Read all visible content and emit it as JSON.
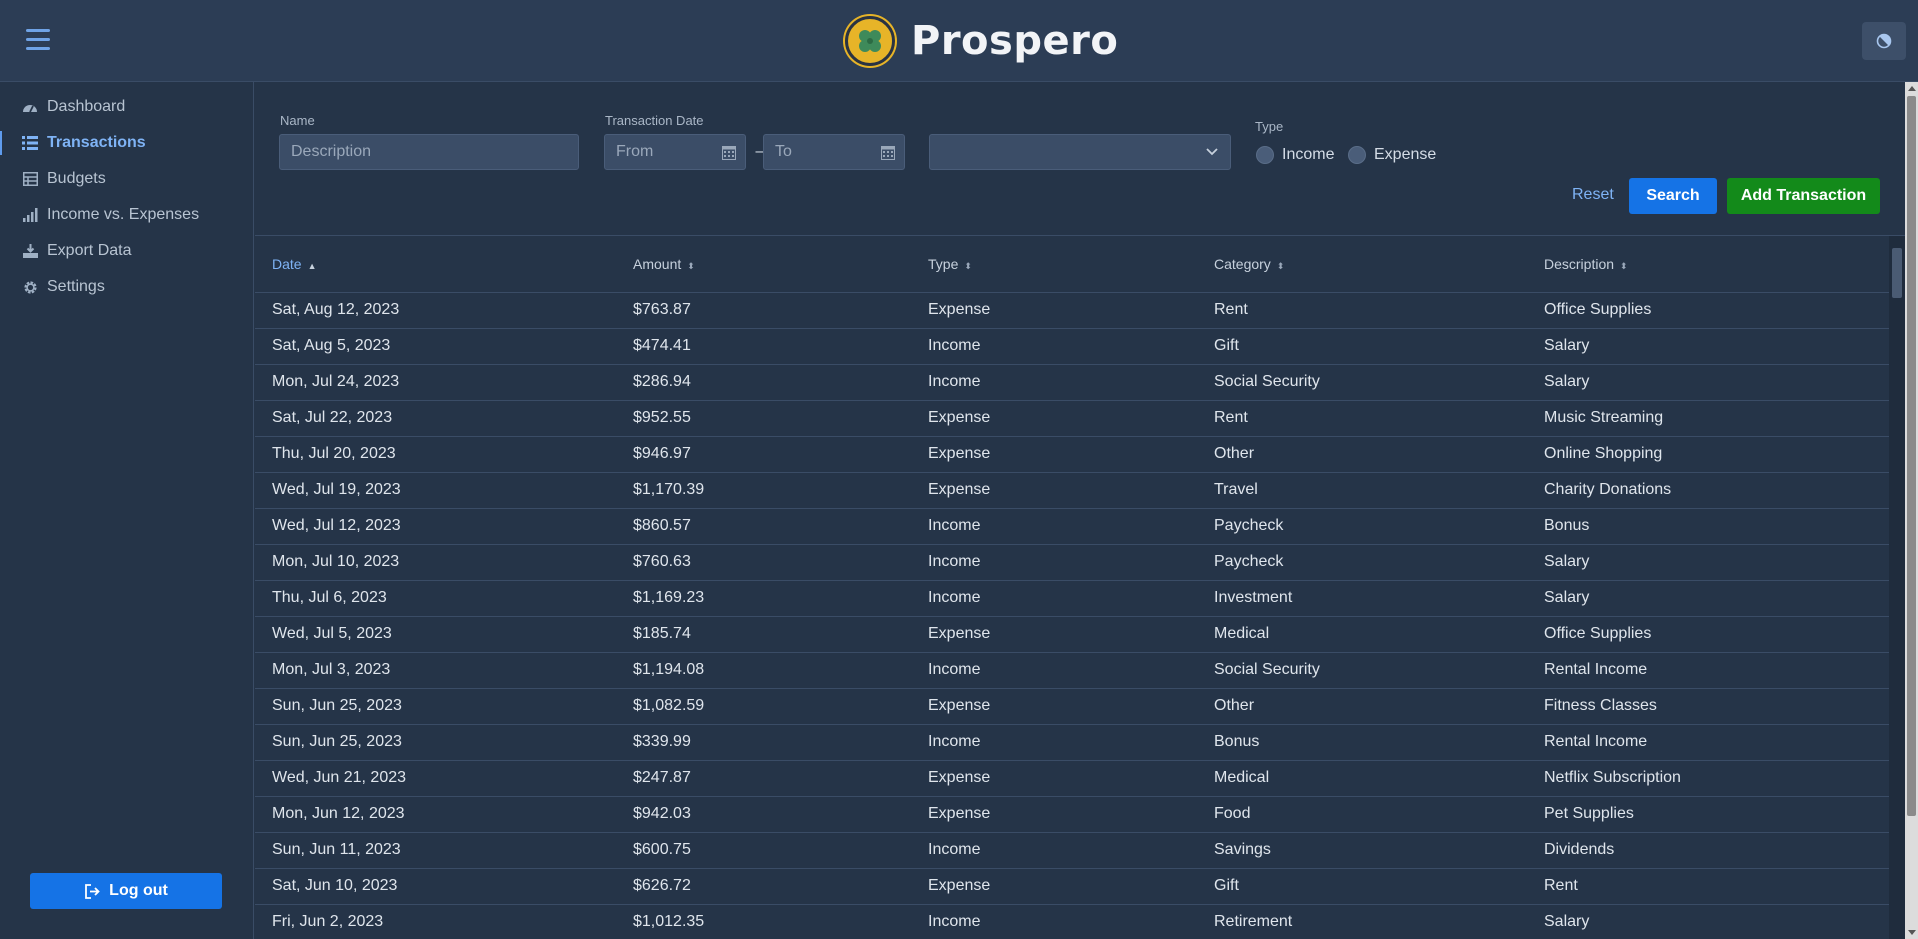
{
  "app": {
    "title": "Prospero"
  },
  "sidebar": {
    "items": [
      {
        "label": "Dashboard",
        "icon": "gauge-icon",
        "active": false
      },
      {
        "label": "Transactions",
        "icon": "list-icon",
        "active": true
      },
      {
        "label": "Budgets",
        "icon": "table-icon",
        "active": false
      },
      {
        "label": "Income vs. Expenses",
        "icon": "bar-chart-icon",
        "active": false
      },
      {
        "label": "Export Data",
        "icon": "download-icon",
        "active": false
      },
      {
        "label": "Settings",
        "icon": "gear-icon",
        "active": false
      }
    ],
    "logout_label": "Log out"
  },
  "filters": {
    "name_label": "Name",
    "name_placeholder": "Description",
    "date_label": "Transaction Date",
    "from_placeholder": "From",
    "date_separator": "–",
    "to_placeholder": "To",
    "category_value": "",
    "type_label": "Type",
    "type_options": [
      "Income",
      "Expense"
    ],
    "reset_label": "Reset",
    "search_label": "Search",
    "add_label": "Add Transaction"
  },
  "colors": {
    "accent": "#1573e6",
    "add_button": "#138a1a",
    "background": "#253448",
    "header": "#2c3d55"
  },
  "table": {
    "sort_column": "Date",
    "sort_direction": "ascending",
    "columns": [
      "Date",
      "Amount",
      "Type",
      "Category",
      "Description"
    ],
    "rows": [
      [
        "Sat, Aug 12, 2023",
        "$763.87",
        "Expense",
        "Rent",
        "Office Supplies"
      ],
      [
        "Sat, Aug 5, 2023",
        "$474.41",
        "Income",
        "Gift",
        "Salary"
      ],
      [
        "Mon, Jul 24, 2023",
        "$286.94",
        "Income",
        "Social Security",
        "Salary"
      ],
      [
        "Sat, Jul 22, 2023",
        "$952.55",
        "Expense",
        "Rent",
        "Music Streaming"
      ],
      [
        "Thu, Jul 20, 2023",
        "$946.97",
        "Expense",
        "Other",
        "Online Shopping"
      ],
      [
        "Wed, Jul 19, 2023",
        "$1,170.39",
        "Expense",
        "Travel",
        "Charity Donations"
      ],
      [
        "Wed, Jul 12, 2023",
        "$860.57",
        "Income",
        "Paycheck",
        "Bonus"
      ],
      [
        "Mon, Jul 10, 2023",
        "$760.63",
        "Income",
        "Paycheck",
        "Salary"
      ],
      [
        "Thu, Jul 6, 2023",
        "$1,169.23",
        "Income",
        "Investment",
        "Salary"
      ],
      [
        "Wed, Jul 5, 2023",
        "$185.74",
        "Expense",
        "Medical",
        "Office Supplies"
      ],
      [
        "Mon, Jul 3, 2023",
        "$1,194.08",
        "Income",
        "Social Security",
        "Rental Income"
      ],
      [
        "Sun, Jun 25, 2023",
        "$1,082.59",
        "Expense",
        "Other",
        "Fitness Classes"
      ],
      [
        "Sun, Jun 25, 2023",
        "$339.99",
        "Income",
        "Bonus",
        "Rental Income"
      ],
      [
        "Wed, Jun 21, 2023",
        "$247.87",
        "Expense",
        "Medical",
        "Netflix Subscription"
      ],
      [
        "Mon, Jun 12, 2023",
        "$942.03",
        "Expense",
        "Food",
        "Pet Supplies"
      ],
      [
        "Sun, Jun 11, 2023",
        "$600.75",
        "Income",
        "Savings",
        "Dividends"
      ],
      [
        "Sat, Jun 10, 2023",
        "$626.72",
        "Expense",
        "Gift",
        "Rent"
      ],
      [
        "Fri, Jun 2, 2023",
        "$1,012.35",
        "Income",
        "Retirement",
        "Salary"
      ]
    ]
  }
}
